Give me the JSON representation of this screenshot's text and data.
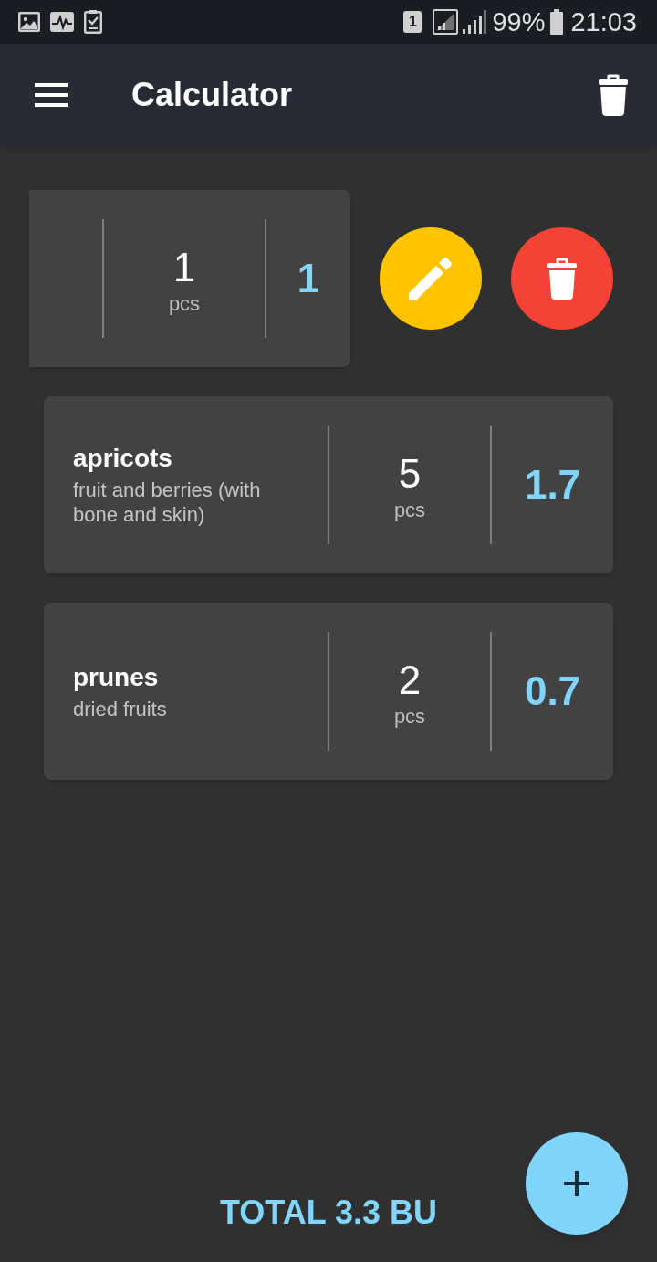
{
  "status_bar": {
    "sim_slot": "1",
    "battery": "99%",
    "time": "21:03"
  },
  "app_bar": {
    "title": "Calculator"
  },
  "items": [
    {
      "swiped": true,
      "quantity": "1",
      "unit": "pcs",
      "value": "1"
    },
    {
      "swiped": false,
      "name": "apricots",
      "description": "fruit and berries (with bone and skin)",
      "quantity": "5",
      "unit": "pcs",
      "value": "1.7"
    },
    {
      "swiped": false,
      "name": "prunes",
      "description": "dried fruits",
      "quantity": "2",
      "unit": "pcs",
      "value": "0.7"
    }
  ],
  "total": "TOTAL 3.3 BU"
}
